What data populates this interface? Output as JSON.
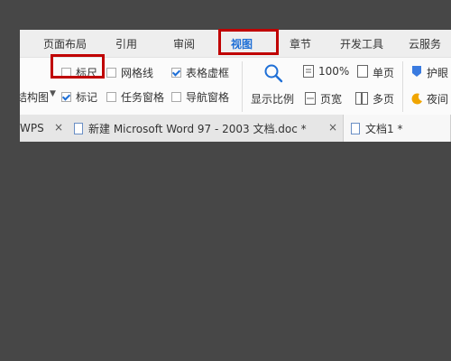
{
  "menubar": {
    "items": [
      {
        "label": "页面布局"
      },
      {
        "label": "引用"
      },
      {
        "label": "审阅"
      },
      {
        "label": "视图"
      },
      {
        "label": "章节"
      },
      {
        "label": "开发工具"
      },
      {
        "label": "云服务"
      }
    ],
    "active_index": 3
  },
  "ribbon": {
    "show_group": {
      "ruler": {
        "label": "标尺",
        "checked": false
      },
      "gridlines": {
        "label": "网格线",
        "checked": false
      },
      "table_gridlines": {
        "label": "表格虚框",
        "checked": true
      },
      "outline_label": "结构图",
      "marks": {
        "label": "标记",
        "checked": true
      },
      "task_pane": {
        "label": "任务窗格",
        "checked": false
      },
      "nav_pane": {
        "label": "导航窗格",
        "checked": false
      }
    },
    "zoom_group": {
      "display_ratio_label": "显示比例",
      "zoom_100_label": "100%",
      "page_width_label": "页宽",
      "single_page_label": "单页",
      "multi_page_label": "多页"
    },
    "extra": {
      "eye_protect_label": "护眼",
      "night_label": "夜间"
    }
  },
  "tabs": {
    "items": [
      {
        "label": "WPS"
      },
      {
        "label": "新建 Microsoft Word 97 - 2003 文档.doc *"
      },
      {
        "label": "文档1 *"
      }
    ],
    "close_glyph": "×"
  },
  "colors": {
    "accent": "#1e6fd6",
    "highlight": "#c00000",
    "backdrop": "#474747"
  }
}
